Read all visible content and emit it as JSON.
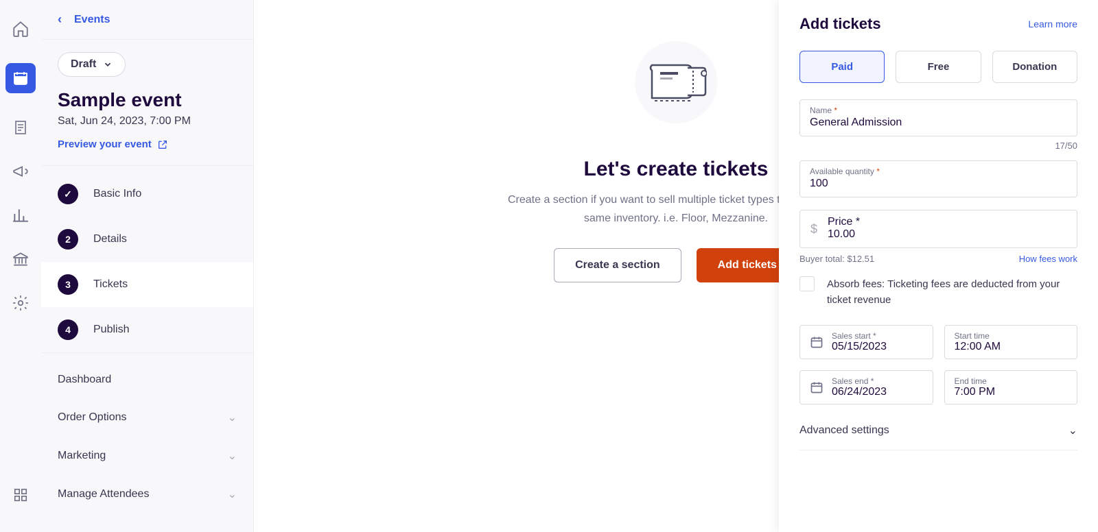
{
  "crumb": {
    "label": "Events"
  },
  "status": {
    "label": "Draft"
  },
  "event": {
    "title": "Sample event",
    "datetime": "Sat, Jun 24, 2023, 7:00 PM",
    "preview": "Preview your event"
  },
  "steps": [
    {
      "num": "✓",
      "label": "Basic Info"
    },
    {
      "num": "2",
      "label": "Details"
    },
    {
      "num": "3",
      "label": "Tickets"
    },
    {
      "num": "4",
      "label": "Publish"
    }
  ],
  "menu": {
    "dashboard": "Dashboard",
    "order": "Order Options",
    "marketing": "Marketing",
    "attendees": "Manage Attendees"
  },
  "hero": {
    "title": "Let's create tickets",
    "desc": "Create a section if you want to sell multiple ticket types that share the same inventory. i.e. Floor, Mezzanine.",
    "section_btn": "Create a section",
    "add_btn": "Add tickets"
  },
  "panel": {
    "title": "Add tickets",
    "learn": "Learn more",
    "tabs": {
      "paid": "Paid",
      "free": "Free",
      "donation": "Donation"
    },
    "name_label": "Name",
    "name_value": "General Admission",
    "name_counter": "17/50",
    "qty_label": "Available quantity",
    "qty_value": "100",
    "price_label": "Price",
    "price_currency": "$",
    "price_value": "10.00",
    "buyer_total": "Buyer total: $12.51",
    "fees_link": "How fees work",
    "absorb": "Absorb fees: Ticketing fees are deducted from your ticket revenue",
    "sales_start_label": "Sales start",
    "sales_start_value": "05/15/2023",
    "start_time_label": "Start time",
    "start_time_value": "12:00 AM",
    "sales_end_label": "Sales end",
    "sales_end_value": "06/24/2023",
    "end_time_label": "End time",
    "end_time_value": "7:00 PM",
    "advanced": "Advanced settings"
  }
}
